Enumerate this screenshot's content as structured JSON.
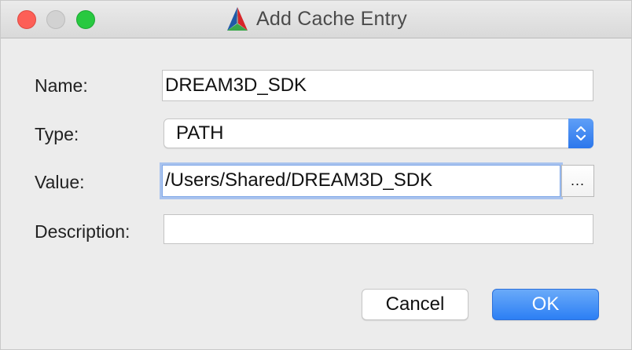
{
  "window": {
    "title": "Add Cache Entry"
  },
  "form": {
    "name": {
      "label": "Name:",
      "value": "DREAM3D_SDK"
    },
    "type": {
      "label": "Type:",
      "value": "PATH"
    },
    "value": {
      "label": "Value:",
      "value": "/Users/Shared/DREAM3D_SDK",
      "browse_label": "..."
    },
    "description": {
      "label": "Description:",
      "value": ""
    }
  },
  "buttons": {
    "cancel_label": "Cancel",
    "ok_label": "OK"
  },
  "colors": {
    "accent": "#2c7ff4",
    "focus_ring": "#a9c3ee",
    "close": "#fd5f57",
    "minimize": "#d2d2d2",
    "maximize": "#28c940"
  },
  "icons": {
    "app": "cmake-triangle-icon",
    "type_dropdown": "up-down-chevron-icon"
  }
}
